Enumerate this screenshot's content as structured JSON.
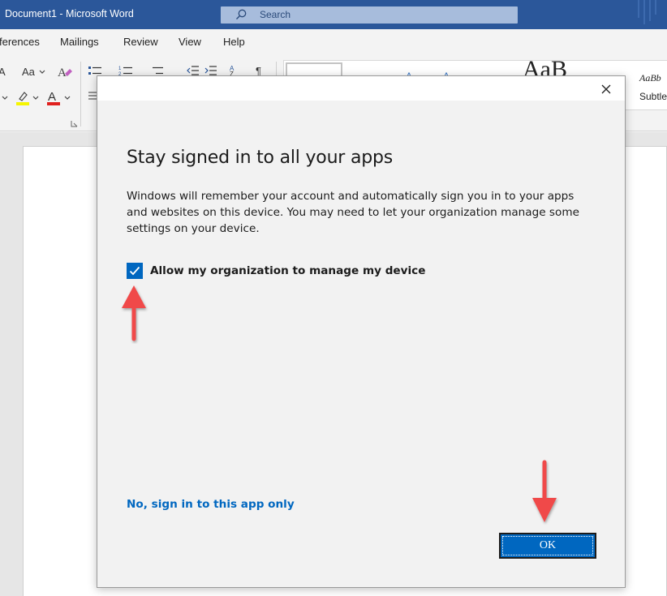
{
  "titlebar": {
    "title": "Document1  -  Microsoft Word",
    "search_placeholder": "Search"
  },
  "tabs": [
    "ferences",
    "Mailings",
    "Review",
    "View",
    "Help"
  ],
  "ribbon": {
    "font_grow": "A",
    "change_case": "Aa",
    "style_subtle": "Subtle",
    "style_aabb": "AaBb",
    "style_big": "AaB"
  },
  "dialog": {
    "title": "Stay signed in to all your apps",
    "body": "Windows will remember your account and automatically sign you in to your apps and websites on this device. You may need to let your organization manage some settings on your device.",
    "checkbox_label": "Allow my organization to manage my device",
    "checkbox_checked": true,
    "link": "No, sign in to this app only",
    "ok": "OK"
  },
  "colors": {
    "titlebar": "#2b579a",
    "accent": "#0067c0",
    "arrow": "#f04a4a"
  }
}
